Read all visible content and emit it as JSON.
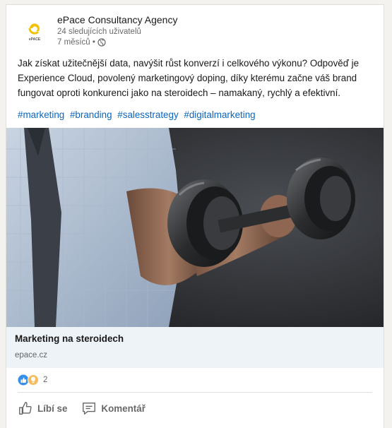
{
  "post": {
    "author": {
      "name": "ePace Consultancy Agency",
      "followers": "24 sledujících uživatelů",
      "time": "7 měsíců •",
      "logo_text": "ePACE",
      "logo_color": "#f2c200"
    },
    "text": "Jak získat užitečnější data, navýšit růst konverzí i celkového výkonu? Odpověď je Experience Cloud, povolený marketingový doping, díky kterému začne váš brand fungovat oproti konkurenci jako na steroidech – namakaný, rychlý a efektivní.",
    "hashtags": [
      "#marketing",
      "#branding",
      "#salesstrategy",
      "#digitalmarketing"
    ],
    "image_icon": "dumbbell-photo",
    "article": {
      "title": "Marketing na steroidech",
      "domain": "epace.cz"
    },
    "reactions": {
      "icons": [
        "like-reaction-icon",
        "insightful-reaction-icon"
      ],
      "count": "2"
    },
    "actions": {
      "like_label": "Líbí se",
      "comment_label": "Komentář"
    }
  },
  "colors": {
    "link": "#0a66c2",
    "like_blue": "#378fe9",
    "insightful_yellow": "#f5bb5c"
  }
}
